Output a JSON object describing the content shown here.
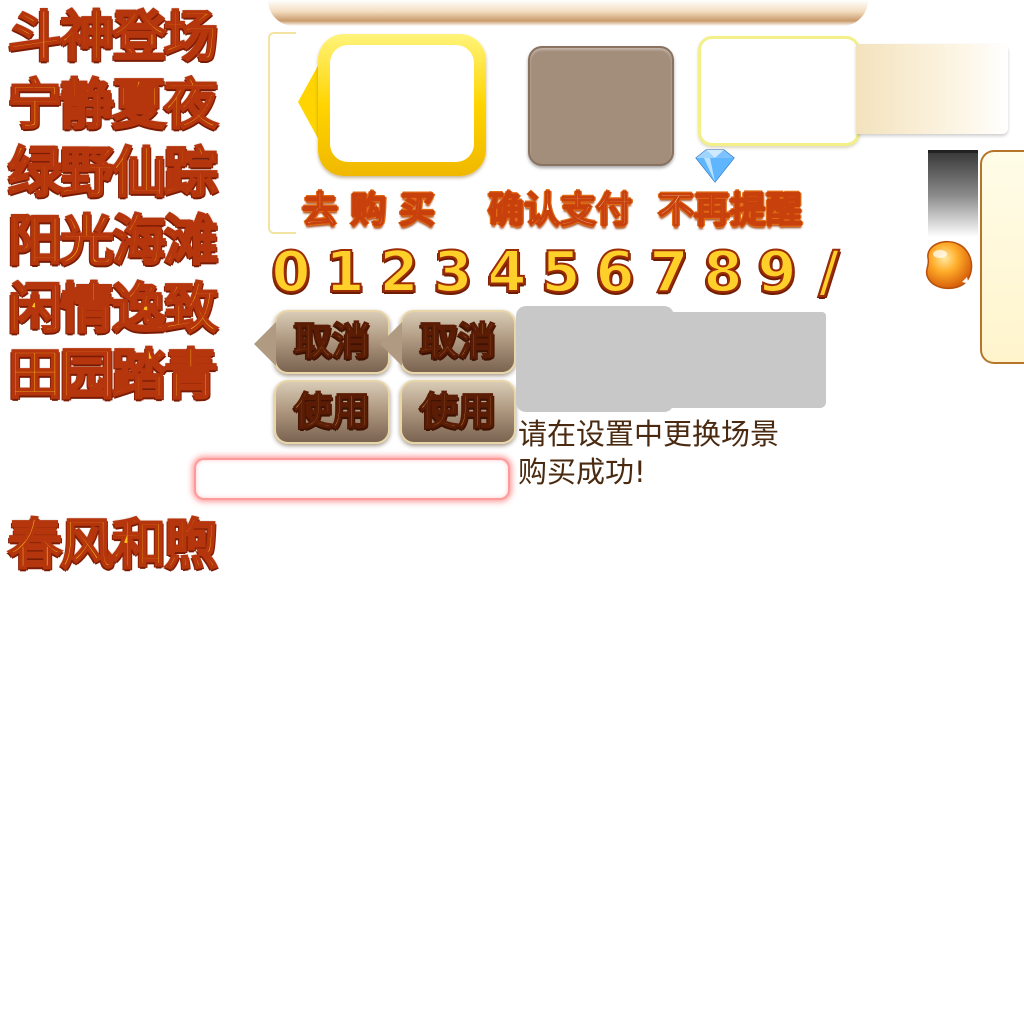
{
  "scene_titles": [
    "斗神登场",
    "宁静夏夜",
    "绿野仙踪",
    "阳光海滩",
    "闲情逸致",
    "田园踏青",
    "春风和煦"
  ],
  "action_labels": {
    "go_buy": "去 购 买",
    "confirm_pay": "确认支付",
    "no_remind": "不再提醒"
  },
  "digits": [
    "0",
    "1",
    "2",
    "3",
    "4",
    "5",
    "6",
    "7",
    "8",
    "9",
    "/"
  ],
  "buttons": {
    "cancel_label": "取消",
    "use_label": "使用"
  },
  "messages": {
    "change_scene_hint": "请在设置中更换场景",
    "purchase_success": "购买成功!"
  },
  "icons": [
    "diamond-gem-icon",
    "orange-bean-icon"
  ],
  "colors": {
    "title_fill": "#ffc21a",
    "title_outline": "#b5360c",
    "orange_outline": "#e06a14",
    "button_brown": "#b09a82",
    "slot_yellow": "#ffd400",
    "slot_brown": "#a38e7c"
  }
}
